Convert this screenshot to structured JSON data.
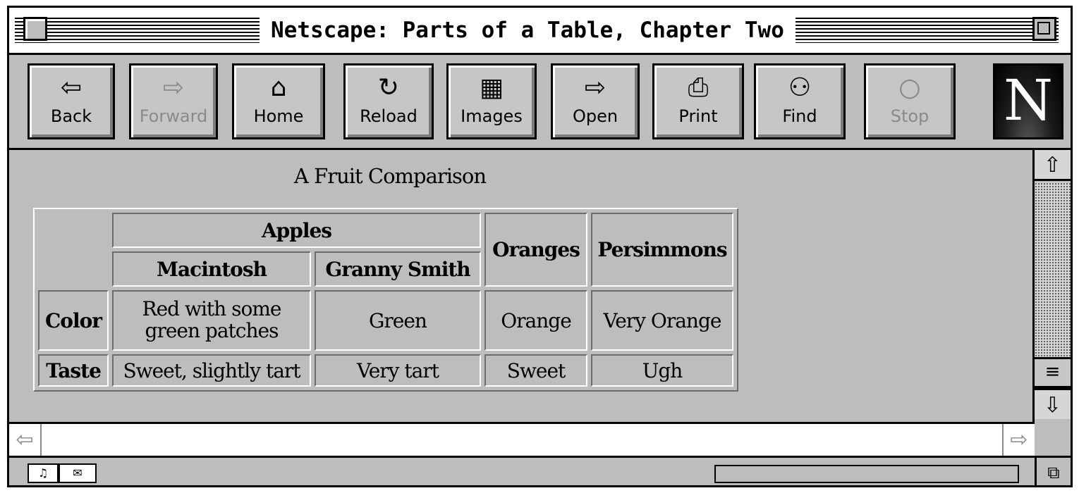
{
  "window": {
    "title": "Netscape: Parts of a Table, Chapter Two"
  },
  "toolbar": {
    "buttons": [
      {
        "label": "Back",
        "icon": "back-arrow-icon",
        "glyph": "⇦",
        "enabled": true
      },
      {
        "label": "Forward",
        "icon": "forward-arrow-icon",
        "glyph": "⇨",
        "enabled": false
      },
      {
        "label": "Home",
        "icon": "home-icon",
        "glyph": "⌂",
        "enabled": true
      },
      {
        "label": "Reload",
        "icon": "reload-icon",
        "glyph": "↻",
        "enabled": true
      },
      {
        "label": "Images",
        "icon": "images-icon",
        "glyph": "▦",
        "enabled": true
      },
      {
        "label": "Open",
        "icon": "open-icon",
        "glyph": "⇨",
        "enabled": true
      },
      {
        "label": "Print",
        "icon": "printer-icon",
        "glyph": "⎙",
        "enabled": true
      },
      {
        "label": "Find",
        "icon": "binoculars-icon",
        "glyph": "⚇",
        "enabled": true
      },
      {
        "label": "Stop",
        "icon": "stop-icon",
        "glyph": "○",
        "enabled": false
      }
    ],
    "logo": "N"
  },
  "page": {
    "caption": "A Fruit Comparison",
    "table": {
      "group_header": "Apples",
      "subheaders": [
        "Macintosh",
        "Granny Smith"
      ],
      "headers": [
        "Oranges",
        "Persimmons"
      ],
      "rows": [
        {
          "label": "Color",
          "cells": [
            "Red with some green patches",
            "Green",
            "Orange",
            "Very Orange"
          ]
        },
        {
          "label": "Taste",
          "cells": [
            "Sweet, slightly tart",
            "Very tart",
            "Sweet",
            "Ugh"
          ]
        }
      ]
    }
  },
  "colors": {
    "chrome": "#bdbdbd",
    "bezel_light": "#ffffff",
    "bezel_dark": "#6b6b6b"
  }
}
